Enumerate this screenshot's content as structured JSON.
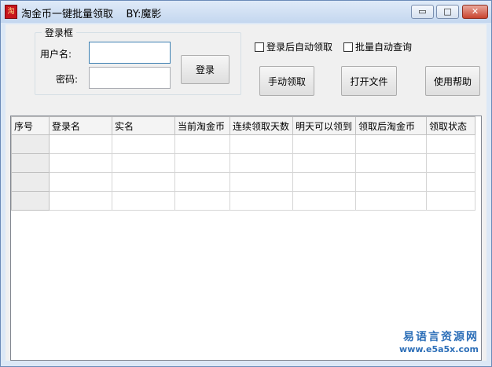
{
  "window": {
    "title": "淘金币一键批量领取    BY:魔影",
    "icon_glyph": "淘",
    "controls": {
      "minimize": "▭",
      "maximize": "□",
      "close": "✕"
    }
  },
  "login_group": {
    "title": "登录框",
    "username_label": "用户名:",
    "username_value": "",
    "password_label": "密码:",
    "password_value": "",
    "login_button": "登录"
  },
  "options": {
    "auto_claim_after_login": {
      "label": "登录后自动领取",
      "checked": false
    },
    "batch_auto_query": {
      "label": "批量自动查询",
      "checked": false
    }
  },
  "buttons": {
    "manual_claim": "手动领取",
    "open_file": "打开文件",
    "help": "使用帮助"
  },
  "table": {
    "columns": [
      "序号",
      "登录名",
      "实名",
      "当前淘金币",
      "连续领取天数",
      "明天可以领到",
      "领取后淘金币",
      "领取状态"
    ],
    "rows": [
      [
        "",
        "",
        "",
        "",
        "",
        "",
        "",
        ""
      ],
      [
        "",
        "",
        "",
        "",
        "",
        "",
        "",
        ""
      ],
      [
        "",
        "",
        "",
        "",
        "",
        "",
        "",
        ""
      ],
      [
        "",
        "",
        "",
        "",
        "",
        "",
        "",
        ""
      ]
    ]
  },
  "watermark": {
    "line1": "易语言资源网",
    "line2": "www.e5a5x.com"
  },
  "colors": {
    "title_gradient_top": "#dfeaf8",
    "title_gradient_bottom": "#c4d7ef",
    "close_button": "#c9442f",
    "watermark": "#2d6fb8"
  }
}
